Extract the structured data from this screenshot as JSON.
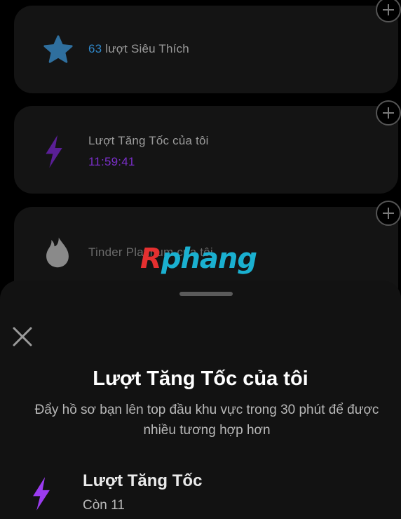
{
  "cards": {
    "super_likes": {
      "count": "63",
      "label": " lượt Siêu Thích",
      "icon": "star-icon",
      "count_color": "#2f86c7"
    },
    "boosts": {
      "label": "Lượt Tăng Tốc của tôi",
      "timer": "11:59:41",
      "icon": "bolt-icon",
      "timer_color": "#8b34e0"
    },
    "platinum": {
      "label": "Tinder Platinum của tôi",
      "icon": "tinder-flame-icon"
    }
  },
  "watermark": {
    "first": "R",
    "rest": "phang"
  },
  "sheet": {
    "title": "Lượt Tăng Tốc của tôi",
    "description": "Đẩy hồ sơ bạn lên top đầu khu vực trong 30 phút để được nhiều tương hợp hơn",
    "item": {
      "title": "Lượt Tăng Tốc",
      "count": "Còn 11",
      "icon": "bolt-icon"
    }
  },
  "colors": {
    "accent_blue": "#2f86c7",
    "accent_purple": "#8b34e0",
    "background": "#000000",
    "sheet": "#121212"
  }
}
